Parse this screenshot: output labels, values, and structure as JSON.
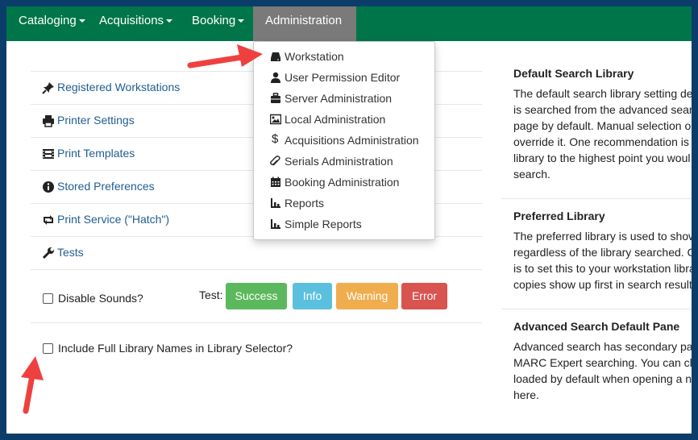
{
  "nav": {
    "items": [
      {
        "label": "Cataloging"
      },
      {
        "label": "Acquisitions"
      },
      {
        "label": "Booking"
      },
      {
        "label": "Administration"
      }
    ]
  },
  "dropdown": {
    "items": [
      {
        "label": "Workstation",
        "icon": "hdd-icon"
      },
      {
        "label": "User Permission Editor",
        "icon": "user-icon"
      },
      {
        "label": "Server Administration",
        "icon": "briefcase-icon"
      },
      {
        "label": "Local Administration",
        "icon": "picture-icon"
      },
      {
        "label": "Acquisitions Administration",
        "icon": "dollar-icon"
      },
      {
        "label": "Serials Administration",
        "icon": "paperclip-icon"
      },
      {
        "label": "Booking Administration",
        "icon": "calendar-icon"
      },
      {
        "label": "Reports",
        "icon": "stats-icon"
      },
      {
        "label": "Simple Reports",
        "icon": "stats-icon"
      }
    ]
  },
  "links": [
    {
      "label": "Registered Workstations",
      "icon": "pushpin-icon"
    },
    {
      "label": "Printer Settings",
      "icon": "print-icon"
    },
    {
      "label": "Print Templates",
      "icon": "film-icon"
    },
    {
      "label": "Stored Preferences",
      "icon": "info-sign-icon"
    },
    {
      "label": "Print Service (\"Hatch\")",
      "icon": "retweet-icon"
    },
    {
      "label": "Tests",
      "icon": "wrench-icon"
    }
  ],
  "sounds": {
    "disable_label": "Disable Sounds?",
    "test_label": "Test:",
    "buttons": [
      {
        "label": "Success",
        "color": "#5cb85c"
      },
      {
        "label": "Info",
        "color": "#5bc0de"
      },
      {
        "label": "Warning",
        "color": "#f0ad4e"
      },
      {
        "label": "Error",
        "color": "#d9534f"
      }
    ]
  },
  "full_names_label": "Include Full Library Names in Library Selector?",
  "sidebar": [
    {
      "title": "Default Search Library",
      "text": "The default search library setting de\nis searched from the advanced sear\npage by default. Manual selection o\noverride it. One recommendation is\nlibrary to the highest point you woul\nsearch."
    },
    {
      "title": "Preferred Library",
      "text": "The preferred library is used to show\nregardless of the library searched. C\nis to set this to your workstation libra\ncopies show up first in search result"
    },
    {
      "title": "Advanced Search Default Pane",
      "text": "Advanced search has secondary pa\nMARC Expert searching. You can ch\nloaded by default when opening a n\nhere."
    }
  ],
  "colors": {
    "navbar": "#00754a",
    "nav_active": "#7a7a7a",
    "link": "#1f5d8f",
    "arrow": "#ef4040",
    "frame": "#0a3d6a"
  }
}
